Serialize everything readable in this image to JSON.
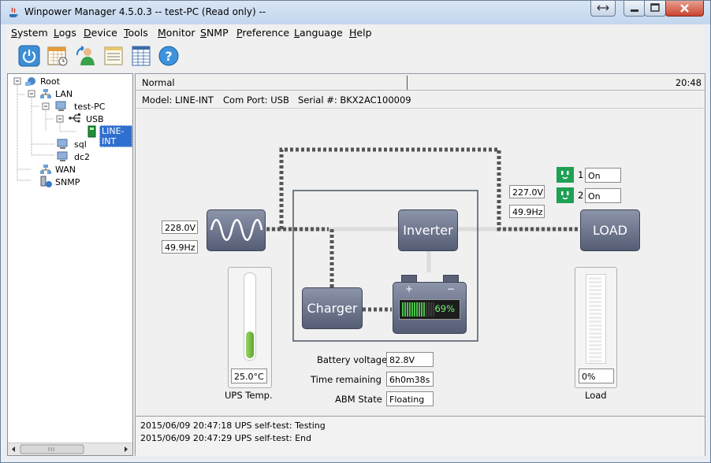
{
  "window": {
    "title": "Winpower Manager 4.5.0.3 -- test-PC (Read only) --"
  },
  "menu": [
    {
      "label": "System",
      "u": "S",
      "rest": "ystem"
    },
    {
      "label": "Logs",
      "u": "L",
      "rest": "ogs"
    },
    {
      "label": "Device",
      "u": "D",
      "rest": "evice"
    },
    {
      "label": "Tools",
      "u": "T",
      "rest": "ools"
    },
    {
      "label": "Monitor",
      "u": "M",
      "rest": "onitor"
    },
    {
      "label": "SNMP",
      "u": "S",
      "rest": "NMP"
    },
    {
      "label": "Preference",
      "u": "P",
      "rest": "reference"
    },
    {
      "label": "Language",
      "u": "L",
      "rest": "anguage"
    },
    {
      "label": "Help",
      "u": "H",
      "rest": "elp"
    }
  ],
  "toolbar": {
    "icons": [
      "power-icon",
      "calendar-icon",
      "user-icon",
      "list-icon",
      "table-icon",
      "help-icon"
    ]
  },
  "tree": {
    "root": "Root",
    "lan": "LAN",
    "test_pc": "test-PC",
    "usb": "USB",
    "line_int": "LINE-INT",
    "sql": "sql",
    "dc2": "dc2",
    "wan": "WAN",
    "snmp": "SNMP"
  },
  "status": {
    "text": "Normal",
    "time": "20:48"
  },
  "info": {
    "model": "Model: LINE-INT",
    "port": "Com Port: USB",
    "serial": "Serial #: BKX2AC100009"
  },
  "input": {
    "voltage": "228.0V",
    "frequency": "49.9Hz"
  },
  "output": {
    "voltage": "227.0V",
    "frequency": "49.9Hz"
  },
  "outlets": [
    {
      "num": "1",
      "state": "On"
    },
    {
      "num": "2",
      "state": "On"
    }
  ],
  "blocks": {
    "inverter": "Inverter",
    "charger": "Charger",
    "load": "LOAD"
  },
  "battery": {
    "percent": "69%",
    "fill": 0.69,
    "plus": "+",
    "minus": "−"
  },
  "temperature": {
    "value": "25.0°C",
    "label": "UPS Temp."
  },
  "load": {
    "value": "0%",
    "label": "Load"
  },
  "battery_info": [
    {
      "label": "Battery voltage",
      "value": "82.8V"
    },
    {
      "label": "Time remaining",
      "value": "6h0m38s"
    },
    {
      "label": "ABM State",
      "value": "Floating"
    }
  ],
  "logs": [
    "2015/06/09 20:47:18  UPS self-test: Testing",
    "2015/06/09 20:47:29  UPS self-test: End"
  ],
  "colors": {
    "block_top": "#8c94aa",
    "block_bottom": "#555d75",
    "battery_green": "#4ac04a",
    "outlet_green": "#1fa055"
  }
}
